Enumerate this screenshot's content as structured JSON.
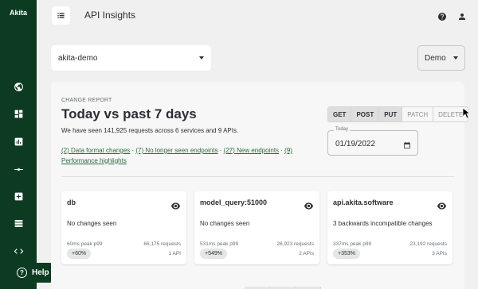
{
  "brand": {
    "name": "Akita"
  },
  "sidebar": {
    "items": [
      {
        "name": "globe-icon"
      },
      {
        "name": "dashboard-icon"
      },
      {
        "name": "bar-chart-icon"
      },
      {
        "name": "merge-arrows-icon"
      },
      {
        "name": "add-box-icon"
      },
      {
        "name": "list-icon"
      },
      {
        "name": "code-icon"
      }
    ]
  },
  "help": {
    "label": "Help"
  },
  "header": {
    "title": "API Insights"
  },
  "project_select": {
    "value": "akita-demo"
  },
  "env_select": {
    "value": "Demo"
  },
  "report": {
    "label": "CHANGE REPORT",
    "title": "Today vs past 7 days",
    "summary": "We have seen 141,925 requests across 6 services and 9 APIs.",
    "links": [
      "(2) Data format changes",
      "(7) No longer seen endpoints",
      "(27) New endpoints",
      "(9) Performance highlights"
    ],
    "separator": " · "
  },
  "methods": [
    {
      "label": "GET",
      "active": true
    },
    {
      "label": "POST",
      "active": true
    },
    {
      "label": "PUT",
      "active": true
    },
    {
      "label": "PATCH",
      "active": false
    },
    {
      "label": "DELETE",
      "active": false
    }
  ],
  "date": {
    "label": "Today",
    "value": "01/19/2022"
  },
  "cards": [
    {
      "title": "db",
      "status": "No changes seen",
      "peak": "60ms peak p99",
      "change": "+60%",
      "requests": "66,175 requests",
      "apis": "1 API"
    },
    {
      "title": "model_query:51000",
      "status": "No changes seen",
      "peak": "531ms peak p99",
      "change": "+549%",
      "requests": "26,923 requests",
      "apis": "2 APIs"
    },
    {
      "title": "api.akita.software",
      "status": "3 backwards incompatible changes",
      "peak": "337ms peak p99",
      "change": "+353%",
      "requests": "23,192 requests",
      "apis": "3 APIs"
    }
  ],
  "colors": {
    "sidebar": "#0d3b22",
    "link": "#2b6b3d",
    "background": "#f0f0f0"
  }
}
